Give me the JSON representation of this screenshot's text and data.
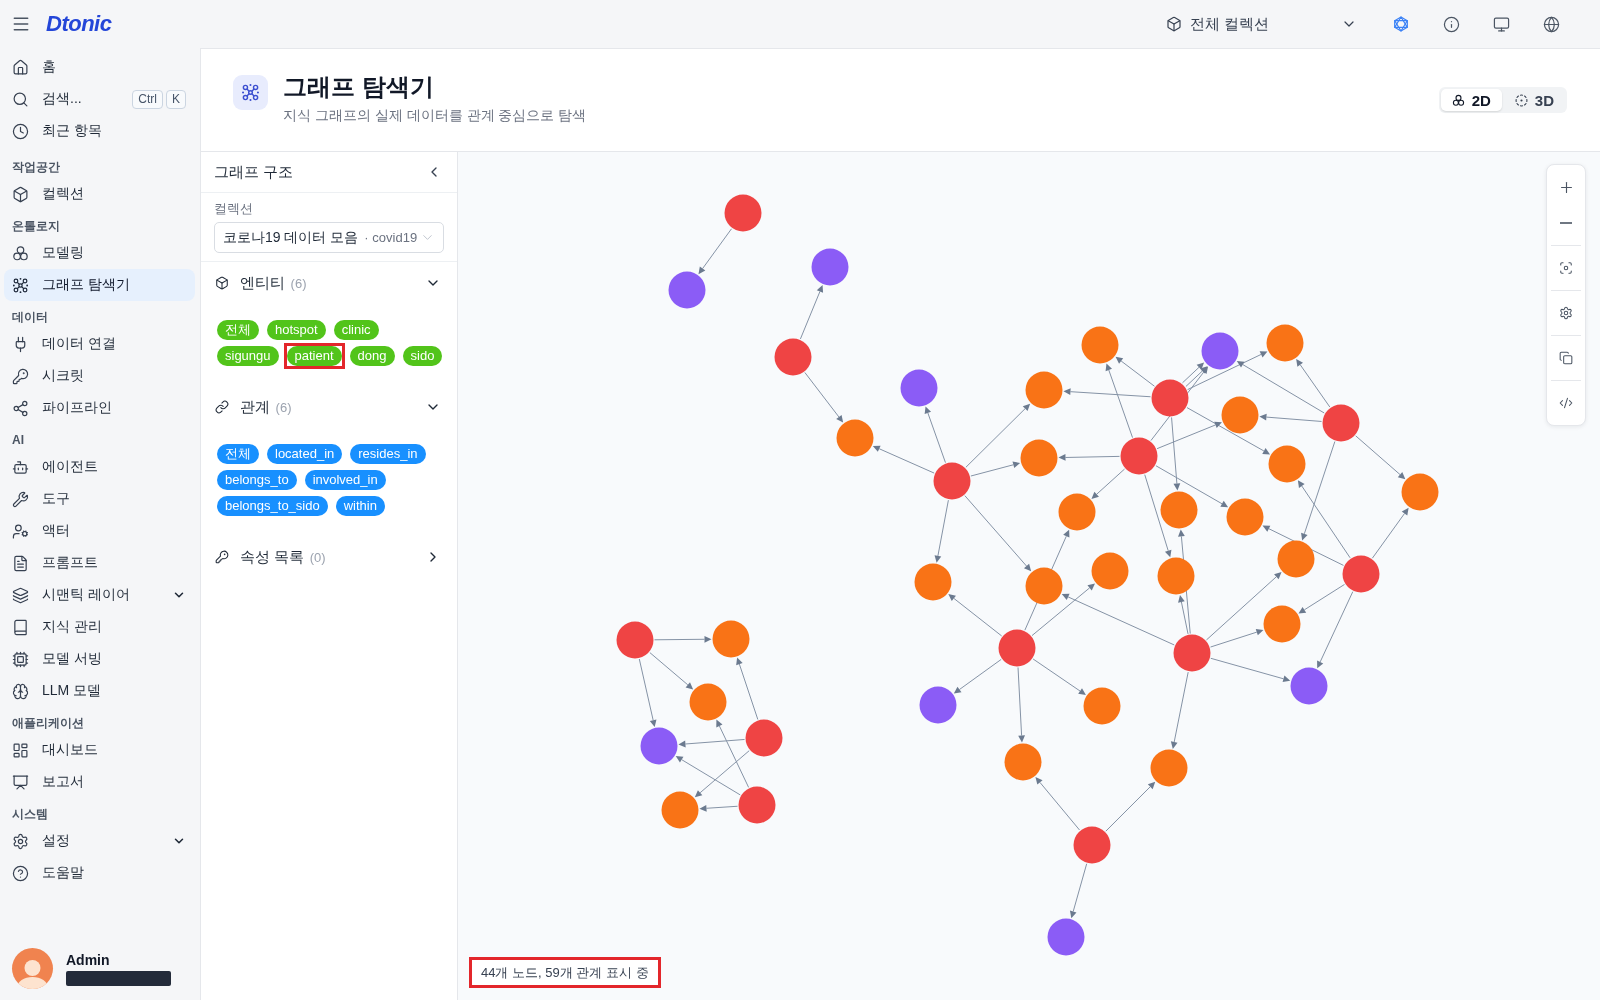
{
  "topbar": {
    "logo": "Dtonic",
    "collection_selector": {
      "label": "전체 컬렉션"
    }
  },
  "sidebar": {
    "items": [
      {
        "label": "홈",
        "kind": "link",
        "selected": false
      },
      {
        "label": "검색...",
        "kind": "link",
        "selected": false,
        "shortcut": [
          "Ctrl",
          "K"
        ]
      },
      {
        "label": "최근 항목",
        "kind": "link",
        "selected": false
      }
    ],
    "sections": [
      {
        "title": "작업공간",
        "items": [
          {
            "label": "컬렉션",
            "kind": "link",
            "selected": false
          }
        ]
      },
      {
        "title": "온톨로지",
        "items": [
          {
            "label": "모델링",
            "kind": "link",
            "selected": false
          },
          {
            "label": "그래프 탐색기",
            "kind": "link",
            "selected": true
          }
        ]
      },
      {
        "title": "데이터",
        "items": [
          {
            "label": "데이터 연결",
            "kind": "link",
            "selected": false
          },
          {
            "label": "시크릿",
            "kind": "link",
            "selected": false
          },
          {
            "label": "파이프라인",
            "kind": "link",
            "selected": false
          }
        ]
      },
      {
        "title": "AI",
        "items": [
          {
            "label": "에이전트",
            "kind": "link",
            "selected": false
          },
          {
            "label": "도구",
            "kind": "link",
            "selected": false
          },
          {
            "label": "액터",
            "kind": "link",
            "selected": false
          },
          {
            "label": "프롬프트",
            "kind": "link",
            "selected": false
          },
          {
            "label": "시맨틱 레이어",
            "kind": "group",
            "expanded": false,
            "selected": false
          },
          {
            "label": "지식 관리",
            "kind": "link",
            "selected": false
          },
          {
            "label": "모델 서빙",
            "kind": "link",
            "selected": false
          },
          {
            "label": "LLM 모델",
            "kind": "link",
            "selected": false
          }
        ]
      },
      {
        "title": "애플리케이션",
        "items": [
          {
            "label": "대시보드",
            "kind": "link",
            "selected": false
          },
          {
            "label": "보고서",
            "kind": "link",
            "selected": false
          }
        ]
      },
      {
        "title": "시스템",
        "items": [
          {
            "label": "설정",
            "kind": "group",
            "expanded": false,
            "selected": false
          },
          {
            "label": "도움말",
            "kind": "link",
            "selected": false
          }
        ]
      }
    ],
    "user": {
      "name": "Admin"
    }
  },
  "page_header": {
    "title": "그래프 탐색기",
    "subtitle": "지식 그래프의 실제 데이터를 관계 중심으로 탐색",
    "view_modes": [
      {
        "label": "2D",
        "selected": true
      },
      {
        "label": "3D",
        "selected": false
      }
    ]
  },
  "panel": {
    "title": "그래프 구조",
    "collection": {
      "label": "컬렉션",
      "value": "코로나19 데이터 모음",
      "suffix": "· covid19"
    },
    "sections": [
      {
        "kind": "entity",
        "title": "엔티티",
        "count": "(6)",
        "expanded": true,
        "chips": [
          {
            "label": "전체",
            "highlighted": false
          },
          {
            "label": "hotspot",
            "highlighted": false
          },
          {
            "label": "clinic",
            "highlighted": false
          },
          {
            "label": "sigungu",
            "highlighted": false
          },
          {
            "label": "patient",
            "highlighted": true
          },
          {
            "label": "dong",
            "highlighted": false
          },
          {
            "label": "sido",
            "highlighted": false
          }
        ]
      },
      {
        "kind": "relation",
        "title": "관계",
        "count": "(6)",
        "expanded": true,
        "chips": [
          {
            "label": "전체"
          },
          {
            "label": "located_in"
          },
          {
            "label": "resides_in"
          },
          {
            "label": "belongs_to"
          },
          {
            "label": "involved_in"
          },
          {
            "label": "belongs_to_sido"
          },
          {
            "label": "within"
          }
        ]
      },
      {
        "kind": "property",
        "title": "속성 목록",
        "count": "(0)",
        "expanded": false
      }
    ]
  },
  "graph": {
    "nodes": [
      {
        "kind": "patient"
      },
      {
        "kind": "region"
      },
      {
        "kind": "region"
      },
      {
        "kind": "patient"
      },
      {
        "kind": "hotspot"
      },
      {
        "kind": "region"
      },
      {
        "kind": "patient"
      },
      {
        "kind": "hotspot"
      },
      {
        "kind": "hotspot"
      },
      {
        "kind": "hotspot"
      },
      {
        "kind": "patient"
      },
      {
        "kind": "region"
      },
      {
        "kind": "hotspot"
      },
      {
        "kind": "patient"
      },
      {
        "kind": "hotspot"
      },
      {
        "kind": "patient"
      },
      {
        "kind": "hotspot"
      },
      {
        "kind": "hotspot"
      },
      {
        "kind": "hotspot"
      },
      {
        "kind": "hotspot"
      },
      {
        "kind": "hotspot"
      },
      {
        "kind": "hotspot"
      },
      {
        "kind": "patient"
      },
      {
        "kind": "hotspot"
      },
      {
        "kind": "hotspot"
      },
      {
        "kind": "hotspot"
      },
      {
        "kind": "hotspot"
      },
      {
        "kind": "hotspot"
      },
      {
        "kind": "patient"
      },
      {
        "kind": "patient"
      },
      {
        "kind": "region"
      },
      {
        "kind": "region"
      },
      {
        "kind": "hotspot"
      },
      {
        "kind": "hotspot"
      },
      {
        "kind": "hotspot"
      },
      {
        "kind": "patient"
      },
      {
        "kind": "region"
      },
      {
        "kind": "patient"
      },
      {
        "kind": "hotspot"
      },
      {
        "kind": "hotspot"
      },
      {
        "kind": "patient"
      },
      {
        "kind": "region"
      },
      {
        "kind": "patient"
      },
      {
        "kind": "hotspot"
      }
    ],
    "status": {
      "text": "44개 노드, 59개 관계 표시 중",
      "highlighted": true
    }
  }
}
